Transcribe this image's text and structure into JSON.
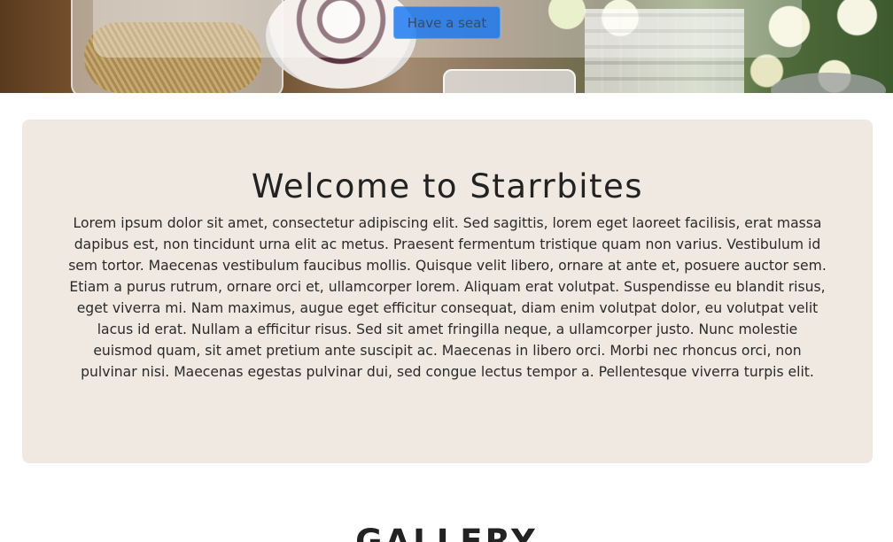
{
  "hero": {
    "cta_label": "Have a seat"
  },
  "welcome": {
    "title": "Welcome to Starrbites",
    "body": "Lorem ipsum dolor sit amet, consectetur adipiscing elit. Sed sagittis, lorem eget laoreet facilisis, erat massa dapibus est, non tincidunt urna elit ac metus. Praesent fermentum tristique quam non varius. Vestibulum id sem tortor. Maecenas vestibulum faucibus mollis. Quisque velit libero, ornare at ante et, posuere auctor sem. Etiam a purus rutrum, ornare orci et, ullamcorper lorem. Aliquam erat volutpat. Suspendisse eu blandit risus, eget viverra mi. Nam maximus, augue eget efficitur consequat, diam enim volutpat dolor, eu volutpat velit lacus id erat. Nullam a efficitur risus. Sed sit amet fringilla neque, a ullamcorper justo. Nunc molestie euismod quam, sit amet pretium ante suscipit ac. Maecenas in libero orci. Morbi nec rhoncus orci, non pulvinar nisi. Maecenas egestas pulvinar dui, sed congue lectus tempor a. Pellentesque viverra turpis elit."
  },
  "next_section": {
    "heading": "GALLERY"
  },
  "colors": {
    "card_background": "#efe9e1",
    "button_blue": "#1676f3"
  }
}
